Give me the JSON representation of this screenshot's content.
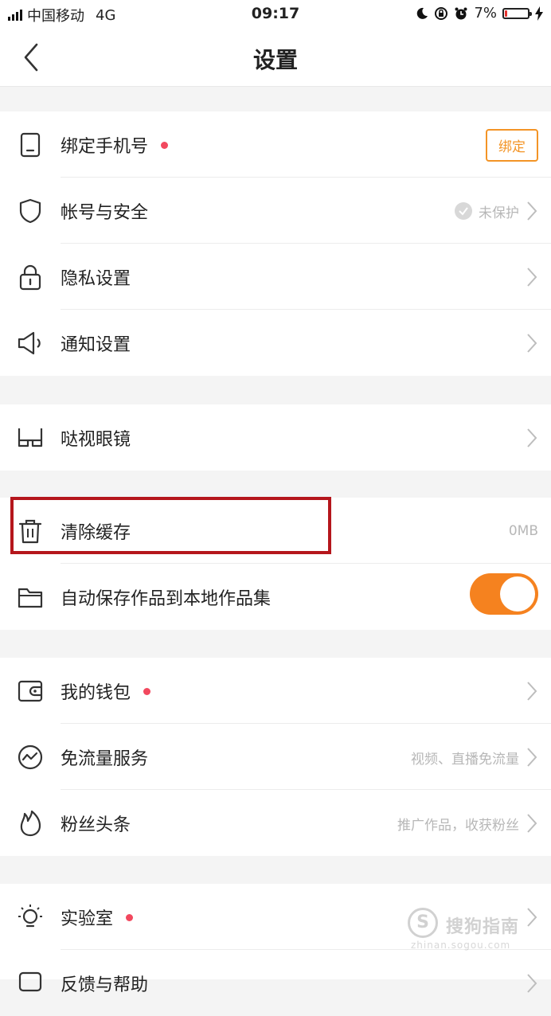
{
  "status_bar": {
    "carrier": "中国移动",
    "network": "4G",
    "time": "09:17",
    "battery": "7%",
    "battery_level": 0.07,
    "battery_color": "#e5322d"
  },
  "nav": {
    "title": "设置",
    "back_icon": "chevron-left-icon"
  },
  "group1": [
    {
      "icon": "phone-icon",
      "label": "绑定手机号",
      "dot": true,
      "action": "绑定"
    },
    {
      "icon": "shield-icon",
      "label": "帐号与安全",
      "hint": "未保护"
    },
    {
      "icon": "lock-icon",
      "label": "隐私设置"
    },
    {
      "icon": "megaphone-icon",
      "label": "通知设置"
    }
  ],
  "group2": [
    {
      "icon": "glasses-icon",
      "label": "哒视眼镜"
    }
  ],
  "group3": [
    {
      "icon": "trash-icon",
      "label": "清除缓存",
      "value": "0MB"
    },
    {
      "icon": "folder-icon",
      "label": "自动保存作品到本地作品集",
      "toggle_on": true
    }
  ],
  "group4": [
    {
      "icon": "wallet-icon",
      "label": "我的钱包",
      "dot": true
    },
    {
      "icon": "trend-icon",
      "label": "免流量服务",
      "hint": "视频、直播免流量"
    },
    {
      "icon": "flame-icon",
      "label": "粉丝头条",
      "hint": "推广作品，收获粉丝"
    }
  ],
  "group5": [
    {
      "icon": "bulb-icon",
      "label": "实验室",
      "dot": true
    },
    {
      "icon": "help-icon",
      "label": "反馈与帮助"
    }
  ],
  "watermark": {
    "text": "搜狗指南",
    "sub": "zhinan.sogou.com"
  },
  "colors": {
    "accent": "#f5821f",
    "dot": "#f2485e",
    "highlight": "#b5161c"
  }
}
